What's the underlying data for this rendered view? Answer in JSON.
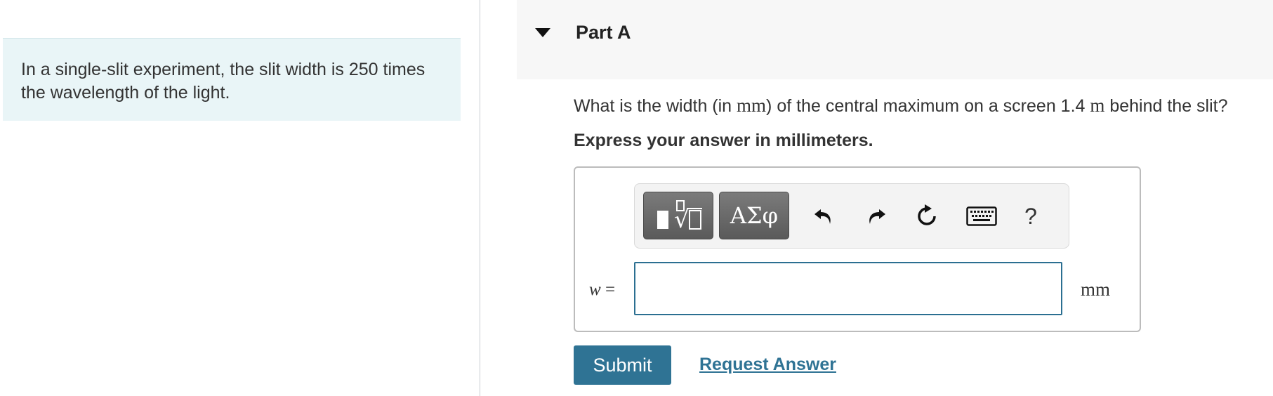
{
  "intro": {
    "text": "In a single-slit experiment, the slit width is 250 times the wavelength of the light."
  },
  "part": {
    "title": "Part A",
    "toggle_icon": "triangle-down-icon"
  },
  "question": {
    "before_unit": "What is the width (in ",
    "unit_inline": "mm",
    "middle": ") of the central maximum on a screen 1.4 ",
    "distance_unit": "m",
    "after": " behind the slit?"
  },
  "instruction": "Express your answer in millimeters.",
  "toolbar": {
    "template_icon": "templates-icon",
    "greek_label": "ΑΣφ",
    "undo_icon": "undo-icon",
    "redo_icon": "redo-icon",
    "reset_icon": "reset-icon",
    "keyboard_icon": "keyboard-icon",
    "help_label": "?"
  },
  "answer": {
    "variable": "w",
    "equals": " =",
    "value": "",
    "unit": "mm"
  },
  "actions": {
    "submit_label": "Submit",
    "request_answer_label": "Request Answer"
  },
  "colors": {
    "intro_bg": "#e9f5f7",
    "accent": "#2f7394",
    "input_border": "#2b6f91"
  }
}
